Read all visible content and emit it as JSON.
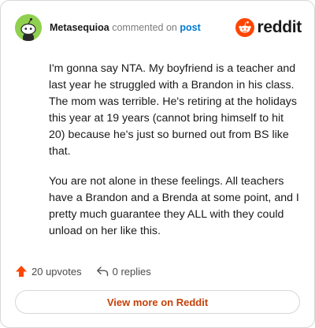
{
  "header": {
    "author": "Metasequioa",
    "action_text": "commented on",
    "post_link": "post",
    "brand_word": "reddit",
    "avatar_color": "#8fd14f",
    "brand_color": "#ff4500"
  },
  "comment": {
    "paragraphs": [
      "I'm gonna say NTA. My boyfriend is a teacher and last year he struggled with a Brandon in his class. The mom was terrible. He's retiring at the holidays this year at 19 years (cannot bring himself to hit 20) because he's just so burned out from BS like that.",
      "You are not alone in these feelings. All teachers have a Brandon and a Brenda at some point, and I pretty much guarantee they ALL with they could unload on her like this."
    ]
  },
  "footer": {
    "upvotes": "20 upvotes",
    "replies": "0 replies",
    "upvote_icon": "upvote-arrow-icon",
    "reply_icon": "reply-arrow-icon"
  },
  "cta": {
    "label": "View more on Reddit"
  }
}
